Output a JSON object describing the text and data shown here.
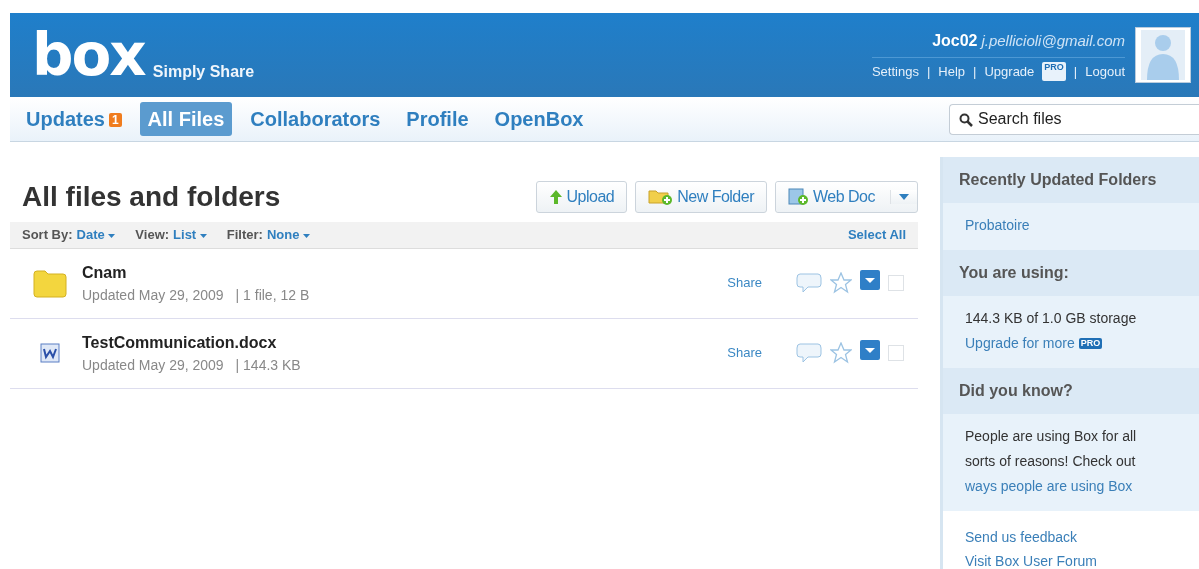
{
  "header": {
    "logo": "box",
    "tagline": "Simply Share",
    "username": "Joc02",
    "email": "j.pellicioli@gmail.com",
    "separator": "|",
    "links": [
      {
        "label": "Settings"
      },
      {
        "label": "Help"
      },
      {
        "label": "Upgrade",
        "badge": "PRO"
      },
      {
        "label": "Logout"
      }
    ]
  },
  "tabs": [
    {
      "label": "Updates",
      "badge": "1",
      "selected": false
    },
    {
      "label": "All Files",
      "selected": true
    },
    {
      "label": "Collaborators",
      "selected": false
    },
    {
      "label": "Profile",
      "selected": false
    },
    {
      "label": "OpenBox",
      "selected": false
    }
  ],
  "search": {
    "placeholder": "Search files"
  },
  "main": {
    "title": "All files and folders",
    "buttons": [
      {
        "kind": "upload",
        "label": "Upload"
      },
      {
        "kind": "folder",
        "label": "New Folder"
      },
      {
        "kind": "webdoc",
        "label": "Web Doc",
        "dropdown": true
      }
    ],
    "toolbar": [
      {
        "label": "Sort By:",
        "value": "Date"
      },
      {
        "label": "View:",
        "value": "List"
      },
      {
        "label": "Filter:",
        "value": "None"
      }
    ],
    "select_all": "Select All",
    "items": [
      {
        "kind": "folder",
        "name": "Cnam",
        "updated": "Updated May 29, 2009",
        "info": "| 1 file, 12 B",
        "share": "Share",
        "checked": false
      },
      {
        "kind": "word",
        "name": "TestCommunication.docx",
        "updated": "Updated May 29, 2009",
        "info": "| 144.3 KB",
        "share": "Share",
        "checked": false
      }
    ]
  },
  "sidebar": {
    "sections": [
      {
        "title": "Recently Updated Folders",
        "links": [
          "Probatoire"
        ]
      },
      {
        "title": "You are using:",
        "text": "144.3 KB of 1.0 GB storage",
        "link": "Upgrade for more",
        "badge": "PRO"
      },
      {
        "title": "Did you know?",
        "text": "People are using Box for all sorts of reasons! Check out",
        "link": "ways people are using Box"
      }
    ],
    "footer_links": [
      "Send us feedback",
      "Visit Box User Forum"
    ]
  }
}
